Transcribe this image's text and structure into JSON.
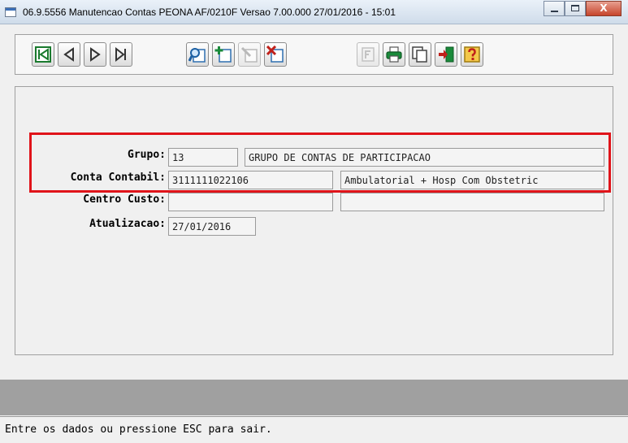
{
  "window": {
    "title": "06.9.5556 Manutencao Contas PEONA AF/0210F Versao 7.00.000 27/01/2016 - 15:01",
    "close_glyph": "X"
  },
  "toolbar": {
    "buttons": [
      {
        "id": "first-record",
        "icon": "first-record-icon",
        "enabled": true
      },
      {
        "id": "previous-record",
        "icon": "previous-record-icon",
        "enabled": true
      },
      {
        "id": "next-record",
        "icon": "next-record-icon",
        "enabled": true
      },
      {
        "id": "last-record",
        "icon": "last-record-icon",
        "enabled": true
      },
      {
        "id": "search",
        "icon": "search-icon",
        "enabled": true
      },
      {
        "id": "add",
        "icon": "add-record-icon",
        "enabled": true
      },
      {
        "id": "edit",
        "icon": "edit-record-icon",
        "enabled": false
      },
      {
        "id": "delete",
        "icon": "delete-record-icon",
        "enabled": true
      },
      {
        "id": "filter",
        "icon": "filter-icon",
        "enabled": false
      },
      {
        "id": "print",
        "icon": "print-icon",
        "enabled": true
      },
      {
        "id": "copy",
        "icon": "copy-icon",
        "enabled": true
      },
      {
        "id": "exit",
        "icon": "exit-icon",
        "enabled": true
      },
      {
        "id": "help",
        "icon": "help-icon",
        "enabled": true
      }
    ]
  },
  "form": {
    "grupo": {
      "label": "Grupo:",
      "code": "13",
      "description": "GRUPO DE CONTAS DE PARTICIPACAO"
    },
    "conta_contabil": {
      "label": "Conta Contabil:",
      "code": "3111111022106",
      "description": "Ambulatorial + Hosp Com Obstetric"
    },
    "centro_custo": {
      "label": "Centro Custo:",
      "code": "",
      "description": ""
    },
    "atualizacao": {
      "label": "Atualizacao:",
      "value": "27/01/2016"
    }
  },
  "status": {
    "message": "Entre os dados ou pressione ESC para sair."
  },
  "colors": {
    "highlight": "#e0141a",
    "window_bg": "#f0f0f0",
    "status_strip": "#a0a0a0"
  }
}
